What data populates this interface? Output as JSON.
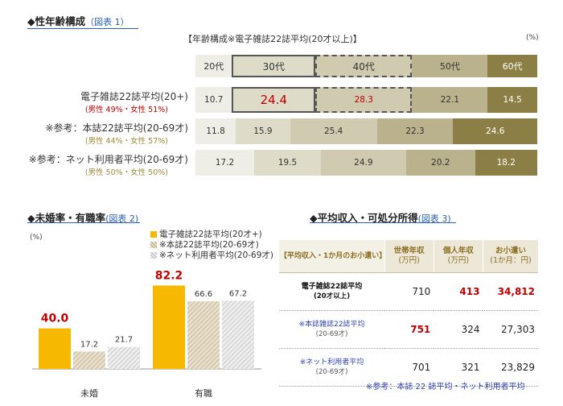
{
  "section1": {
    "title": "◆性年齢構成",
    "link": "（図表 1）",
    "chart_title": "【年齢構成※電子雑誌22誌平均(20才以上)】",
    "unit": "(%)"
  },
  "section2": {
    "title": "◆未婚率・有職率",
    "link": "(図表 2)",
    "unit": "(%)"
  },
  "section3": {
    "title": "◆平均収入・可処分所得",
    "link": "(図表 3)",
    "footnote": "※参考：本誌 22 誌平均・ネット利用者平均"
  },
  "chart_data": [
    {
      "type": "bar",
      "orientation": "horizontal",
      "stacked": true,
      "title": "【年齢構成※電子雑誌22誌平均(20才以上)】",
      "unit": "(%)",
      "categories": [
        "20代",
        "30代",
        "40代",
        "50代",
        "60代"
      ],
      "rows": [
        {
          "label": "電子雑誌22誌平均(20+)",
          "sub": "(男性 49%・女性 51%)",
          "values": [
            10.7,
            24.4,
            28.3,
            22.1,
            14.5
          ]
        },
        {
          "label": "※参考：本誌22誌平均(20-69才)",
          "sub": "(男性 44%・女性 57%)",
          "values": [
            11.8,
            15.9,
            25.4,
            22.3,
            24.6
          ]
        },
        {
          "label": "※参考：ネット利用者平均(20-69才)",
          "sub": "(男性 50%・女性 50%)",
          "values": [
            17.2,
            19.5,
            24.9,
            20.2,
            18.2
          ]
        }
      ],
      "colors": [
        "#efeee6",
        "#dedcc9",
        "#cfcab0",
        "#b9b28c",
        "#8c7f45"
      ],
      "highlight_color": "#c00000"
    },
    {
      "type": "bar",
      "unit": "(%)",
      "categories": [
        "未婚",
        "有職"
      ],
      "series": [
        {
          "name": "電子雑誌22誌平均(20才+)",
          "values": [
            40.0,
            82.2
          ],
          "color": "#f6b800"
        },
        {
          "name": "※本誌22誌平均(20-69才)",
          "values": [
            17.2,
            66.6
          ],
          "color": "#d9cdb6"
        },
        {
          "name": "※ネット利用者平均(20-69才)",
          "values": [
            21.7,
            67.2
          ],
          "color": "#d8d8d8"
        }
      ],
      "ylim": [
        0,
        100
      ]
    },
    {
      "type": "table",
      "header": [
        "【平均収入・1か月のお小遣い】",
        "世帯年収\n(万円)",
        "個人年収\n(万円)",
        "お小遣い\n(1か月：円)"
      ],
      "header_lines": [
        [
          "【平均収入・1か月のお小遣い】"
        ],
        [
          "世帯年収",
          "(万円)"
        ],
        [
          "個人年収",
          "(万円)"
        ],
        [
          "お小遣い",
          "(1か月：円)"
        ]
      ],
      "rows": [
        {
          "label": [
            "電子雑誌22誌平均",
            "(20才以上)"
          ],
          "values": [
            "710",
            "413",
            "34,812"
          ],
          "highlight": [
            false,
            true,
            true
          ]
        },
        {
          "label": [
            "※本誌雑誌22誌平均",
            "(20-69才)"
          ],
          "values": [
            "751",
            "324",
            "27,303"
          ],
          "highlight": [
            true,
            false,
            false
          ]
        },
        {
          "label": [
            "※ネット利用者平均",
            "(20-69才)"
          ],
          "values": [
            "701",
            "321",
            "23,829"
          ],
          "highlight": [
            false,
            false,
            false
          ]
        }
      ]
    }
  ]
}
